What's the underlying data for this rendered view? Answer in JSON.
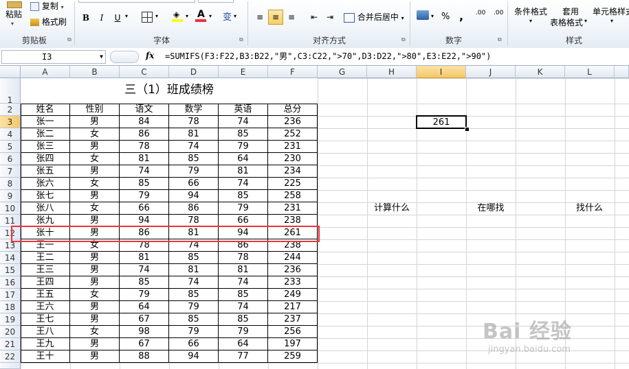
{
  "ribbon": {
    "clipboard": {
      "paste": "粘贴",
      "copy": "复制",
      "format_painter": "格式刷",
      "label": "剪贴板"
    },
    "font": {
      "bold": "B",
      "italic": "I",
      "underline": "U",
      "font_color_letter": "A",
      "phonetic": "变",
      "label": "字体"
    },
    "alignment": {
      "merge_center": "合并后居中",
      "label": "对齐方式"
    },
    "number": {
      "percent": "%",
      "comma": ",",
      "inc_decimal": ".00",
      "dec_decimal": ".00",
      "label": "数字"
    },
    "styles": {
      "conditional": "条件格式",
      "table_format_1": "套用",
      "table_format_2": "表格格式",
      "cell_styles": "单元格样式",
      "label": "样式"
    }
  },
  "formula_bar": {
    "name_box": "I3",
    "fx": "fx",
    "formula": "=SUMIFS(F3:F22,B3:B22,\"男\",C3:C22,\">70\",D3:D22,\">80\",E3:E22,\">90\")"
  },
  "columns": [
    "A",
    "B",
    "C",
    "D",
    "E",
    "F",
    "G",
    "H",
    "I",
    "J",
    "K",
    "L"
  ],
  "rows": [
    "1",
    "2",
    "3",
    "4",
    "5",
    "6",
    "7",
    "8",
    "9",
    "10",
    "11",
    "12",
    "13",
    "14",
    "15",
    "16",
    "17",
    "18",
    "19",
    "20",
    "21",
    "22"
  ],
  "sheet": {
    "title": "三（1）班成绩榜",
    "headers": [
      "姓名",
      "性别",
      "语文",
      "数学",
      "英语",
      "总分"
    ],
    "data": [
      [
        "张一",
        "男",
        "84",
        "78",
        "74",
        "236"
      ],
      [
        "张二",
        "女",
        "86",
        "81",
        "85",
        "252"
      ],
      [
        "张三",
        "男",
        "78",
        "74",
        "79",
        "231"
      ],
      [
        "张四",
        "女",
        "81",
        "85",
        "64",
        "230"
      ],
      [
        "张五",
        "男",
        "74",
        "79",
        "81",
        "234"
      ],
      [
        "张六",
        "女",
        "85",
        "66",
        "74",
        "225"
      ],
      [
        "张七",
        "男",
        "79",
        "94",
        "85",
        "258"
      ],
      [
        "张八",
        "女",
        "66",
        "86",
        "79",
        "231"
      ],
      [
        "张九",
        "男",
        "94",
        "78",
        "66",
        "238"
      ],
      [
        "张十",
        "男",
        "86",
        "81",
        "94",
        "261"
      ],
      [
        "王一",
        "女",
        "78",
        "74",
        "86",
        "238"
      ],
      [
        "王二",
        "男",
        "81",
        "85",
        "78",
        "244"
      ],
      [
        "王三",
        "男",
        "74",
        "81",
        "81",
        "236"
      ],
      [
        "王四",
        "男",
        "85",
        "74",
        "74",
        "233"
      ],
      [
        "王五",
        "女",
        "79",
        "85",
        "85",
        "249"
      ],
      [
        "王六",
        "男",
        "64",
        "79",
        "74",
        "217"
      ],
      [
        "王七",
        "男",
        "67",
        "85",
        "85",
        "237"
      ],
      [
        "王八",
        "女",
        "98",
        "79",
        "79",
        "256"
      ],
      [
        "王九",
        "男",
        "67",
        "66",
        "64",
        "197"
      ],
      [
        "王十",
        "男",
        "88",
        "94",
        "77",
        "259"
      ]
    ],
    "result_value": "261",
    "annotations": {
      "h10": "计算什么",
      "j10": "在哪找",
      "l10": "找什么"
    }
  },
  "watermark": {
    "brand": "Bai 经验",
    "url": "jingyan.baidu.com"
  },
  "colors": {
    "highlight_box": "#e8343a",
    "selected_header": "#f4c76a"
  }
}
